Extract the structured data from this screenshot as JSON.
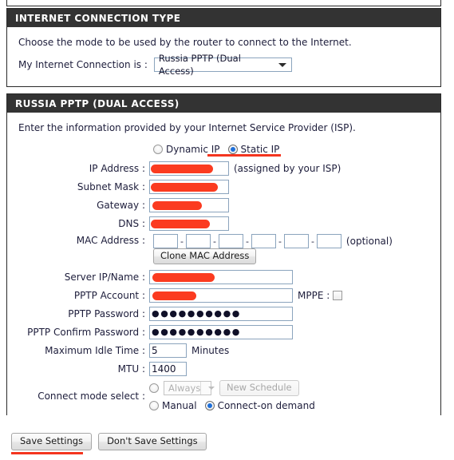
{
  "sections": {
    "connection_type": {
      "title": "INTERNET CONNECTION TYPE",
      "description": "Choose the mode to be used by the router to connect to the Internet.",
      "connection_label": "My Internet Connection is :",
      "connection_value": "Russia PPTP (Dual Access)"
    },
    "russia_pptp": {
      "title": "RUSSIA PPTP (DUAL ACCESS)",
      "description": "Enter the information provided by your Internet Service Provider (ISP).",
      "ip_mode": {
        "dynamic_label": "Dynamic IP",
        "static_label": "Static IP",
        "selected": "Static IP"
      },
      "fields": {
        "ip_address_label": "IP Address :",
        "ip_address_value": "",
        "ip_address_hint": "(assigned by your ISP)",
        "subnet_mask_label": "Subnet Mask :",
        "subnet_mask_value": "",
        "gateway_label": "Gateway :",
        "gateway_value": "",
        "dns_label": "DNS :",
        "dns_value": "",
        "mac_address_label": "MAC Address :",
        "mac_optional_hint": "(optional)",
        "mac_separator": "-",
        "clone_mac_label": "Clone MAC Address",
        "server_ip_label": "Server IP/Name :",
        "server_ip_value": "",
        "pptp_account_label": "PPTP Account :",
        "pptp_account_value": "",
        "mppe_label": "MPPE :",
        "mppe_checked": false,
        "pptp_password_label": "PPTP Password :",
        "pptp_password_value": "●●●●●●●●●●",
        "pptp_confirm_label": "PPTP Confirm Password :",
        "pptp_confirm_value": "●●●●●●●●●●",
        "max_idle_label": "Maximum Idle Time :",
        "max_idle_value": "5",
        "max_idle_units": "Minutes",
        "mtu_label": "MTU :",
        "mtu_value": "1400"
      },
      "connect_mode": {
        "label": "Connect mode select :",
        "always_value": "Always",
        "new_schedule_label": "New Schedule",
        "manual_label": "Manual",
        "on_demand_label": "Connect-on demand",
        "selected": "Connect-on demand"
      }
    }
  },
  "footer": {
    "save_label": "Save Settings",
    "dont_save_label": "Don't Save Settings"
  },
  "annotations": {
    "highlight_color": "#f4351f",
    "redaction_color": "#fb3b20"
  }
}
